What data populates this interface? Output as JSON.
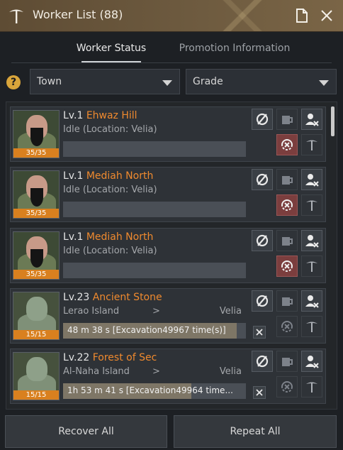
{
  "window": {
    "title": "Worker List (88)"
  },
  "tabs": [
    {
      "label": "Worker Status",
      "active": true
    },
    {
      "label": "Promotion Information",
      "active": false
    }
  ],
  "filters": {
    "help": "?",
    "town": "Town",
    "grade": "Grade"
  },
  "workers": [
    {
      "level": "Lv.1",
      "name": "Ehwaz Hill",
      "status": "Idle (Location: Velia)",
      "stamina": "35/35",
      "type": "human"
    },
    {
      "level": "Lv.1",
      "name": "Mediah North",
      "status": "Idle (Location: Velia)",
      "stamina": "35/35",
      "type": "human"
    },
    {
      "level": "Lv.1",
      "name": "Mediah North",
      "status": "Idle (Location: Velia)",
      "stamina": "35/35",
      "type": "human"
    },
    {
      "level": "Lv.23",
      "name": "Ancient Stone",
      "origin": "Lerao Island",
      "arrow": ">",
      "dest": "Velia",
      "stamina": "15/15",
      "task": "48 m 38 s [Excavation49967 time(s)]",
      "progress": 0.95,
      "type": "goblin"
    },
    {
      "level": "Lv.22",
      "name": "Forest of Sec",
      "origin": "Al-Naha Island",
      "arrow": ">",
      "dest": "Velia",
      "stamina": "15/15",
      "task": "1h 53 m 41 s [Excavation49964 time...",
      "progress": 0.7,
      "type": "goblin"
    }
  ],
  "footer": {
    "recover_all": "Recover All",
    "repeat_all": "Repeat All"
  },
  "colors": {
    "accent_orange": "#f08a2e",
    "stamina_bar": "#d9801f",
    "titlebar": "#6d5a3f"
  }
}
